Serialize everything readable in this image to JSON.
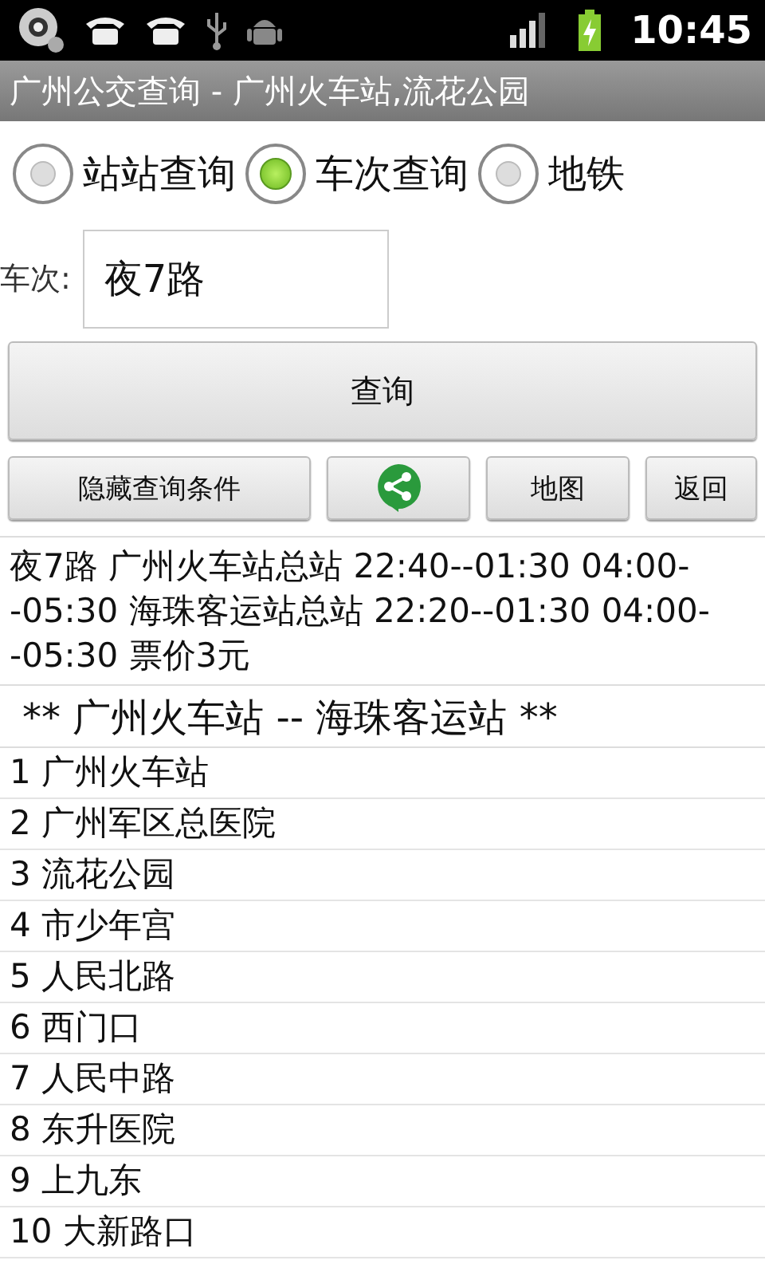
{
  "status_bar": {
    "time": "10:45"
  },
  "window": {
    "title": "广州公交查询 - 广州火车站,流花公园"
  },
  "modes": [
    {
      "label": "站站查询",
      "selected": false
    },
    {
      "label": "车次查询",
      "selected": true
    },
    {
      "label": "地铁",
      "selected": false
    }
  ],
  "route_field": {
    "label": "车次:",
    "value": "夜7路"
  },
  "query_button": "查询",
  "actions": [
    {
      "kind": "text",
      "label": "隐藏查询条件"
    },
    {
      "kind": "share"
    },
    {
      "kind": "text",
      "label": "地图"
    },
    {
      "kind": "text",
      "label": "返回"
    }
  ],
  "info": "夜7路 广州火车站总站 22:40--01:30 04:00--05:30 海珠客运站总站 22:20--01:30 04:00--05:30 票价3元",
  "direction": "** 广州火车站 -- 海珠客运站 **",
  "stops": [
    "1 广州火车站",
    "2 广州军区总医院",
    "3 流花公园",
    "4 市少年宫",
    "5 人民北路",
    "6 西门口",
    "7 人民中路",
    "8 东升医院",
    "9 上九东",
    "10 大新路口"
  ]
}
